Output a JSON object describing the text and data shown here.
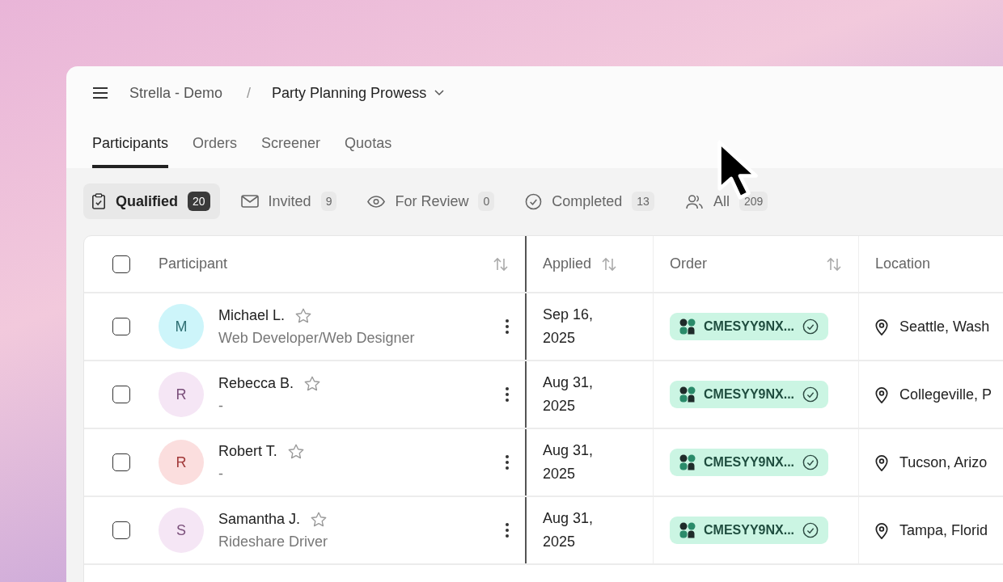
{
  "breadcrumb": {
    "workspace": "Strella - Demo",
    "separator": "/",
    "project": "Party Planning Prowess"
  },
  "tabs": [
    {
      "label": "Participants",
      "selected": true
    },
    {
      "label": "Orders",
      "selected": false
    },
    {
      "label": "Screener",
      "selected": false
    },
    {
      "label": "Quotas",
      "selected": false
    }
  ],
  "filters": [
    {
      "kind": "qualified",
      "label": "Qualified",
      "count": "20",
      "selected": true
    },
    {
      "kind": "invited",
      "label": "Invited",
      "count": "9",
      "selected": false
    },
    {
      "kind": "review",
      "label": "For Review",
      "count": "0",
      "selected": false
    },
    {
      "kind": "completed",
      "label": "Completed",
      "count": "13",
      "selected": false
    },
    {
      "kind": "all",
      "label": "All",
      "count": "209",
      "selected": false
    }
  ],
  "table": {
    "select_all": {
      "checked": false
    },
    "columns": [
      {
        "label": "Participant",
        "sortable": true
      },
      {
        "label": "Applied",
        "sortable": true
      },
      {
        "label": "Order",
        "sortable": true
      },
      {
        "label": "Location"
      }
    ],
    "rows": [
      {
        "checked": false,
        "initial": "M",
        "color": "#cdf5fa",
        "name": "Michael L.",
        "starred": false,
        "role": "Web Developer/Web Designer",
        "applied": "Sep 16, 2025",
        "order": "CMESYY9NX...",
        "location": "Seattle, Wash"
      },
      {
        "checked": false,
        "initial": "R",
        "color": "#f5e6f5",
        "name": "Rebecca B.",
        "starred": false,
        "role": "-",
        "applied": "Aug 31, 2025",
        "order": "CMESYY9NX...",
        "location": "Collegeville, P"
      },
      {
        "checked": false,
        "initial": "R",
        "color": "#fbdede",
        "name": "Robert T.",
        "starred": false,
        "role": "-",
        "applied": "Aug 31, 2025",
        "order": "CMESYY9NX...",
        "location": "Tucson, Arizo"
      },
      {
        "checked": false,
        "initial": "S",
        "color": "#f5e6f5",
        "name": "Samantha J.",
        "starred": false,
        "role": "Rideshare Driver",
        "applied": "Aug 31, 2025",
        "order": "CMESYY9NX...",
        "location": "Tampa, Florid"
      }
    ]
  }
}
